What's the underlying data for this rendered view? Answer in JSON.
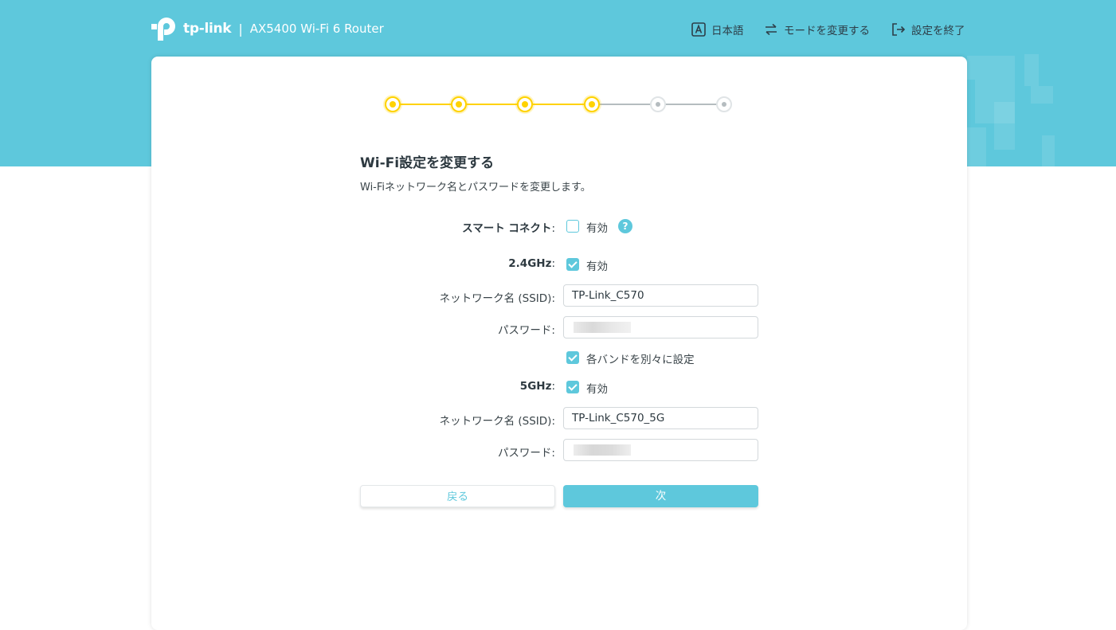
{
  "header": {
    "brand": "tp-link",
    "separator": "|",
    "model": "AX5400 Wi-Fi 6 Router",
    "nav": [
      {
        "label": "日本語",
        "icon": "language-icon"
      },
      {
        "label": "モードを変更する",
        "icon": "swap-mode-icon"
      },
      {
        "label": "設定を終了",
        "icon": "exit-icon"
      }
    ]
  },
  "stepper": {
    "total_steps": 6,
    "completed_steps": 4,
    "done_color": "#ffd200",
    "todo_color": "#b5bcbf"
  },
  "page": {
    "title": "Wi-Fi設定を変更する",
    "subtitle": "Wi-Fiネットワーク名とパスワードを変更します。"
  },
  "form": {
    "smart_connect": {
      "label": "スマート コネクト",
      "colon": ":",
      "checkbox_label": "有効",
      "checked": false,
      "help": "?"
    },
    "band_24": {
      "label": "2.4GHz",
      "colon": ":",
      "checkbox_label": "有効",
      "checked": true,
      "ssid_label": "ネットワーク名 (SSID):",
      "ssid_value": "TP-Link_C570",
      "password_label": "パスワード:",
      "password_value": ""
    },
    "separate_bands": {
      "checkbox_label": "各バンドを別々に設定",
      "checked": true
    },
    "band_5": {
      "label": "5GHz",
      "colon": ":",
      "checkbox_label": "有効",
      "checked": true,
      "ssid_label": "ネットワーク名 (SSID):",
      "ssid_value": "TP-Link_C570_5G",
      "password_label": "パスワード:",
      "password_value": ""
    }
  },
  "buttons": {
    "back": "戻る",
    "next": "次"
  },
  "colors": {
    "accent": "#5ec8dc",
    "header_bg": "#5ec8dc",
    "progress": "#ffd200"
  }
}
